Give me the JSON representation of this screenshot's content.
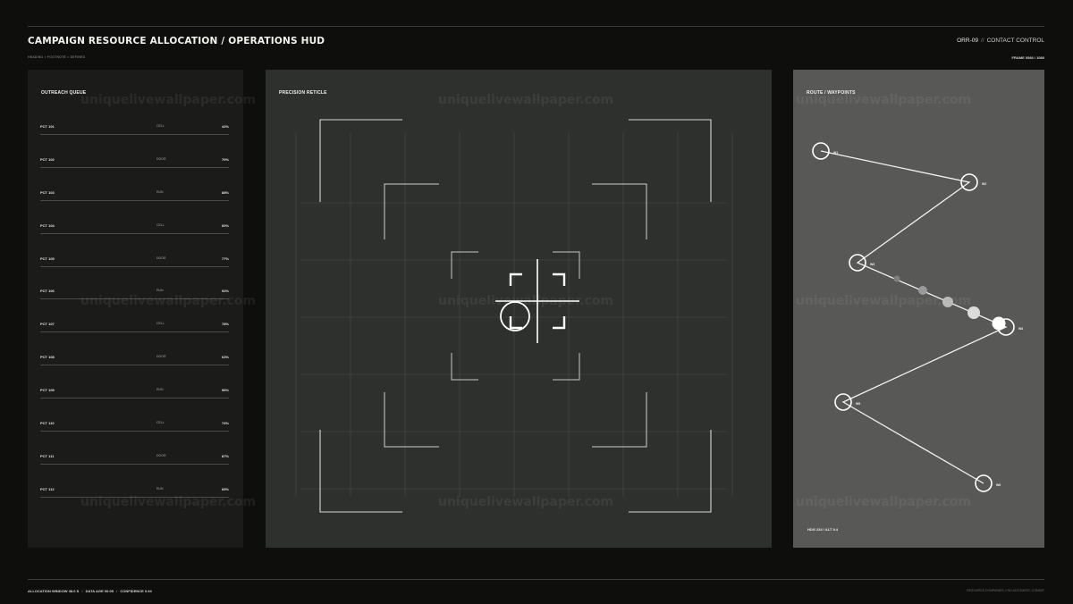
{
  "header": {
    "title": "CAMPAIGN RESOURCE ALLOCATION / OPERATIONS HUD",
    "breadcrumb": "HEADING > FOOTNOTE > DEFINED",
    "code": "ORR-09",
    "separator": "//",
    "mode": "CONTACT CONTROL",
    "frame": "FRAME 0584 / 1080"
  },
  "queue": {
    "title": "OUTREACH QUEUE",
    "rows": [
      {
        "id": "PCT 101",
        "type": "CELL",
        "pct": "42%"
      },
      {
        "id": "PCT 102",
        "type": "DOOR",
        "pct": "70%"
      },
      {
        "id": "PCT 103",
        "type": "RUN",
        "pct": "88%"
      },
      {
        "id": "PCT 104",
        "type": "CELL",
        "pct": "60%"
      },
      {
        "id": "PCT 105",
        "type": "DOOR",
        "pct": "77%"
      },
      {
        "id": "PCT 106",
        "type": "RUN",
        "pct": "92%"
      },
      {
        "id": "PCT 107",
        "type": "CELL",
        "pct": "78%"
      },
      {
        "id": "PCT 108",
        "type": "DOOR",
        "pct": "63%"
      },
      {
        "id": "PCT 109",
        "type": "RUN",
        "pct": "96%"
      },
      {
        "id": "PCT 110",
        "type": "CELL",
        "pct": "74%"
      },
      {
        "id": "PCT 111",
        "type": "DOOR",
        "pct": "87%"
      },
      {
        "id": "PCT 112",
        "type": "RUN",
        "pct": "65%"
      }
    ]
  },
  "reticle": {
    "title": "PRECISION RETICLE",
    "icon": "crosshair-icon"
  },
  "route": {
    "title": "ROUTE / WAYPOINTS",
    "waypoints": [
      "W1",
      "W2",
      "W3",
      "W4",
      "W5",
      "W6"
    ],
    "footer": "HDG 234 / ALT 9.4"
  },
  "footer": {
    "window": "ALLOCATION WINDOW 38.0 S",
    "separator": "/",
    "age": "DATA AGE 00:05",
    "confidence": "CONFIDENCE 0.94",
    "right": "RESOURCE COMPANIES // NO AUTOMATIC COMMIT"
  },
  "watermark": "uniquelivewallpaper.com",
  "colors": {
    "background": "#0e0f0d",
    "queue_panel": "#1b1c1a",
    "reticle_panel": "#2e302d",
    "route_panel": "#585957",
    "line": "#f0f0f0"
  }
}
